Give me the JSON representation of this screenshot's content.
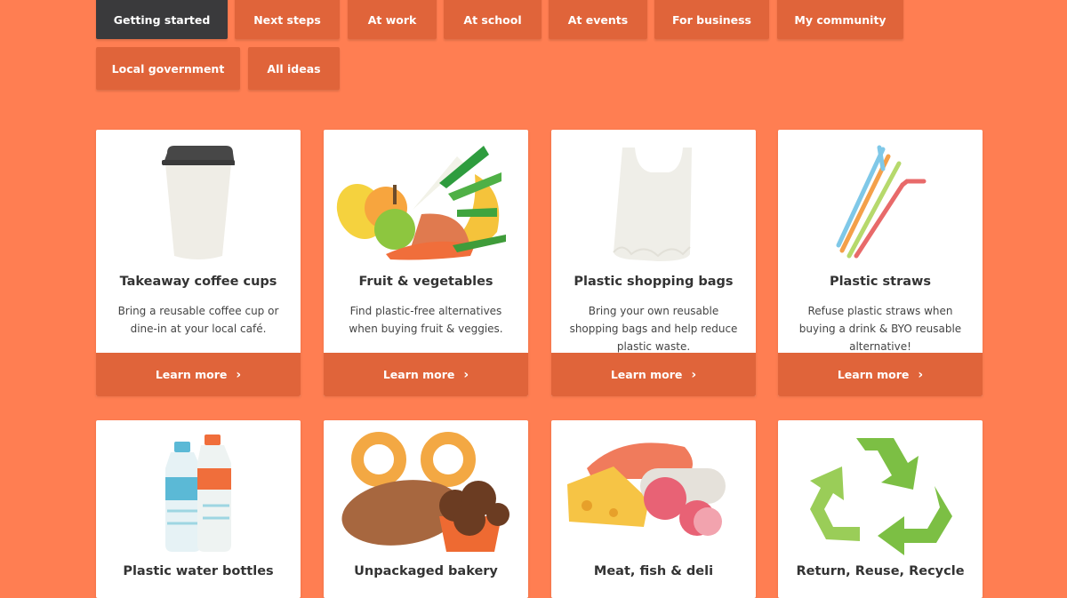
{
  "tabs": {
    "getting_started": "Getting started",
    "next_steps": "Next steps",
    "at_work": "At work",
    "at_school": "At school",
    "at_events": "At events",
    "for_business": "For business",
    "my_community": "My community",
    "local_government": "Local government",
    "all_ideas": "All ideas"
  },
  "cards": [
    {
      "title": "Takeaway coffee cups",
      "desc": "Bring a reusable coffee cup or dine-in at your local café.",
      "cta": "Learn more",
      "icon": "coffee-cup-icon"
    },
    {
      "title": "Fruit & vegetables",
      "desc": "Find plastic-free alternatives when buying fruit & veggies.",
      "cta": "Learn more",
      "icon": "fruit-vegetables-icon"
    },
    {
      "title": "Plastic shopping bags",
      "desc": "Bring your own reusable shopping bags and help reduce plastic waste.",
      "cta": "Learn more",
      "icon": "shopping-bag-icon"
    },
    {
      "title": "Plastic straws",
      "desc": "Refuse plastic straws when buying a drink & BYO reusable alternative!",
      "cta": "Learn more",
      "icon": "straws-icon"
    },
    {
      "title": "Plastic water bottles",
      "icon": "water-bottles-icon"
    },
    {
      "title": "Unpackaged bakery",
      "icon": "bakery-icon"
    },
    {
      "title": "Meat, fish & deli",
      "icon": "deli-icon"
    },
    {
      "title": "Return, Reuse, Recycle",
      "icon": "recycle-icon"
    }
  ],
  "colors": {
    "background": "#FF7E52",
    "tab": "#E0643A",
    "active_tab": "#3A3A3C",
    "cta_bar": "#E0643A"
  }
}
